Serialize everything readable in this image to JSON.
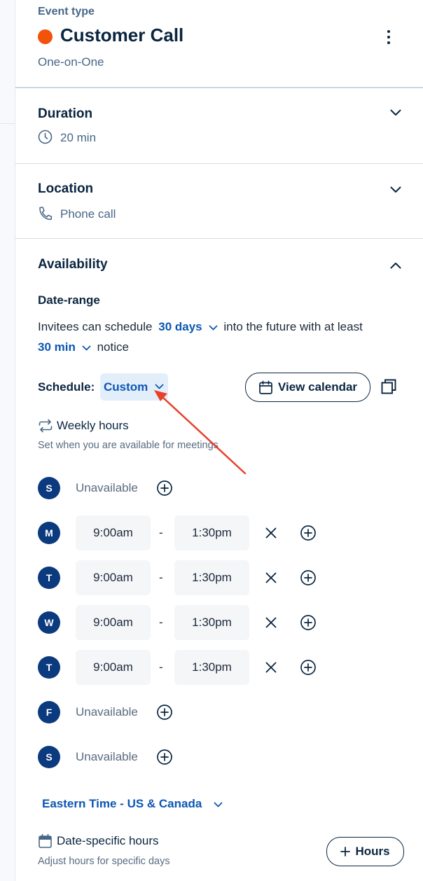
{
  "header": {
    "eyebrow": "Event type",
    "title": "Customer Call",
    "subtitle": "One-on-One",
    "accent_color": "#f2520a"
  },
  "duration": {
    "title": "Duration",
    "value": "20 min",
    "icon": "clock-icon"
  },
  "location": {
    "title": "Location",
    "value": "Phone call",
    "icon": "phone-icon"
  },
  "availability": {
    "title": "Availability",
    "date_range_label": "Date-range",
    "sentence_part1": "Invitees can schedule",
    "range_value": "30 days",
    "sentence_part2": "into the future with at least",
    "notice_value": "30 min",
    "sentence_part3": "notice",
    "schedule_label": "Schedule:",
    "schedule_value": "Custom",
    "view_calendar_label": "View calendar",
    "weekly_hours_title": "Weekly hours",
    "weekly_hours_desc": "Set when you are available for meetings",
    "days": [
      {
        "letter": "S",
        "available": false,
        "text": "Unavailable"
      },
      {
        "letter": "M",
        "available": true,
        "start": "9:00am",
        "end": "1:30pm"
      },
      {
        "letter": "T",
        "available": true,
        "start": "9:00am",
        "end": "1:30pm"
      },
      {
        "letter": "W",
        "available": true,
        "start": "9:00am",
        "end": "1:30pm"
      },
      {
        "letter": "T",
        "available": true,
        "start": "9:00am",
        "end": "1:30pm"
      },
      {
        "letter": "F",
        "available": false,
        "text": "Unavailable"
      },
      {
        "letter": "S",
        "available": false,
        "text": "Unavailable"
      }
    ],
    "dash": "-",
    "timezone": "Eastern Time - US & Canada",
    "date_specific_title": "Date-specific hours",
    "date_specific_desc": "Adjust hours for specific days",
    "add_hours_label": "Hours",
    "colors": {
      "link_blue": "#0b57b3",
      "badge_navy": "#0b3a7e",
      "annotation_red": "#e8412a"
    }
  }
}
